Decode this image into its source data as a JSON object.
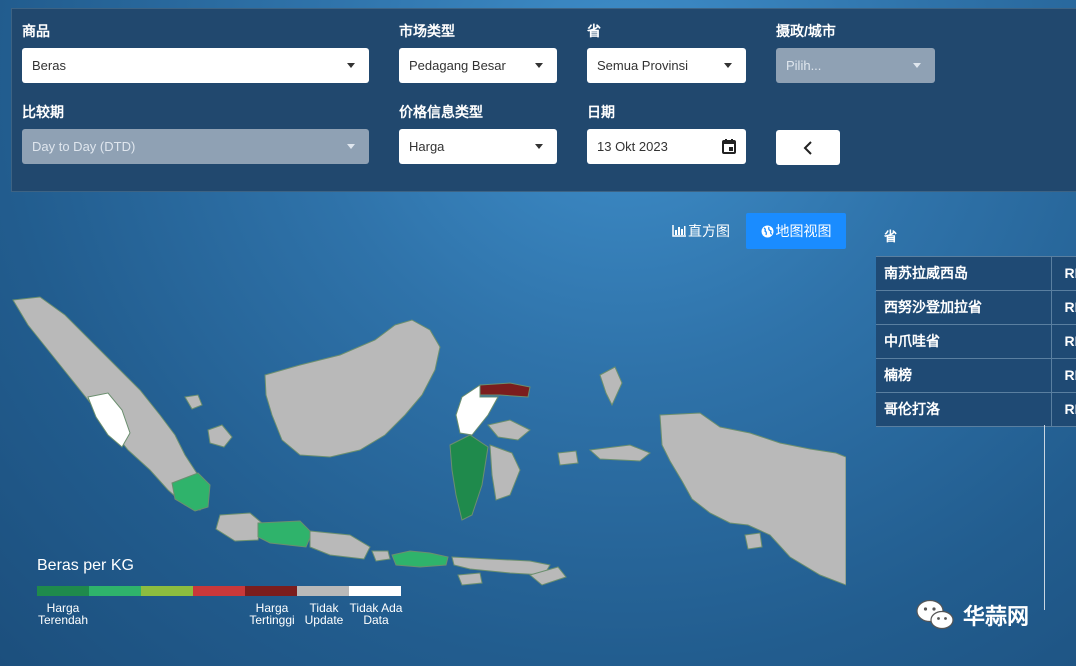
{
  "filters": {
    "commodity": {
      "label": "商品",
      "value": "Beras"
    },
    "market_type": {
      "label": "市场类型",
      "value": "Pedagang Besar"
    },
    "province": {
      "label": "省",
      "value": "Semua Provinsi"
    },
    "regency": {
      "label": "摄政/城市",
      "placeholder": "Pilih..."
    },
    "comparison": {
      "label": "比较期",
      "value": "Day to Day (DTD)"
    },
    "price_info_type": {
      "label": "价格信息类型",
      "value": "Harga"
    },
    "date": {
      "label": "日期",
      "value": "13 Okt 2023"
    }
  },
  "view": {
    "chart_label": "直方图",
    "map_label": "地图视图",
    "active": "map"
  },
  "legend": {
    "title": "Beras per KG",
    "colors": [
      "#1f8a4c",
      "#2fb36b",
      "#8cbd3f",
      "#c9383a",
      "#7b1d1d",
      "#b9b9b9",
      "#ffffff"
    ],
    "labels": {
      "lowest": "Harga Terendah",
      "highest": "Harga Tertinggi",
      "not_updated": "Tidak Update",
      "no_data": "Tidak Ada Data"
    }
  },
  "province_table": {
    "header": "省",
    "rows": [
      {
        "name": "南苏拉威西岛",
        "price": "RP."
      },
      {
        "name": "西努沙登加拉省",
        "price": "RP."
      },
      {
        "name": "中爪哇省",
        "price": "RP."
      },
      {
        "name": "楠榜",
        "price": "RP."
      },
      {
        "name": "哥伦打洛",
        "price": "RP."
      }
    ]
  },
  "watermark": {
    "text": "华蒜网"
  },
  "icons": {
    "dropdown": "caret-down-icon",
    "calendar": "calendar-icon",
    "back": "chevron-left-icon",
    "chart": "bar-chart-icon",
    "globe": "globe-icon",
    "wechat": "wechat-icon"
  }
}
